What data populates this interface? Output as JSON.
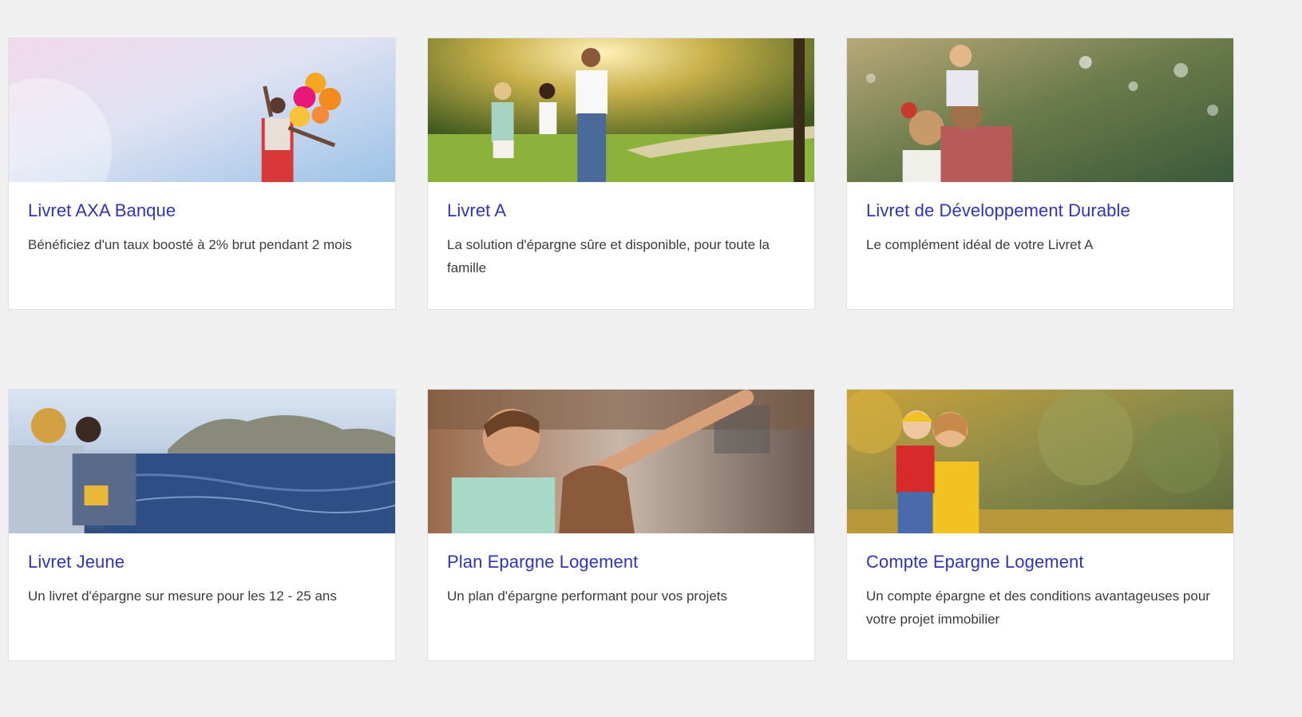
{
  "cards": [
    {
      "title": "Livret AXA Banque",
      "description": "Bénéficiez d'un taux boosté à 2% brut pendant 2 mois",
      "image": "woman-with-balloons-photo"
    },
    {
      "title": "Livret A",
      "description": "La solution d'épargne sûre et disponible, pour toute la famille",
      "image": "family-walking-in-park-photo"
    },
    {
      "title": "Livret de Développement Durable",
      "description": "Le complément idéal de votre Livret A",
      "image": "family-child-on-shoulders-photo"
    },
    {
      "title": "Livret Jeune",
      "description": "Un livret d'épargne sur mesure pour les 12 - 25 ans",
      "image": "friends-by-the-sea-photo"
    },
    {
      "title": "Plan Epargne Logement",
      "description": "Un plan d'épargne performant pour vos projets",
      "image": "couple-pointing-photo"
    },
    {
      "title": "Compte Epargne Logement",
      "description": "Un compte épargne et des conditions avantageuses pour votre projet immobilier",
      "image": "mother-and-child-autumn-photo"
    }
  ],
  "colors": {
    "background": "#f0f0f0",
    "card": "#ffffff",
    "title": "#2e35b8",
    "text": "#3b3b3b"
  }
}
